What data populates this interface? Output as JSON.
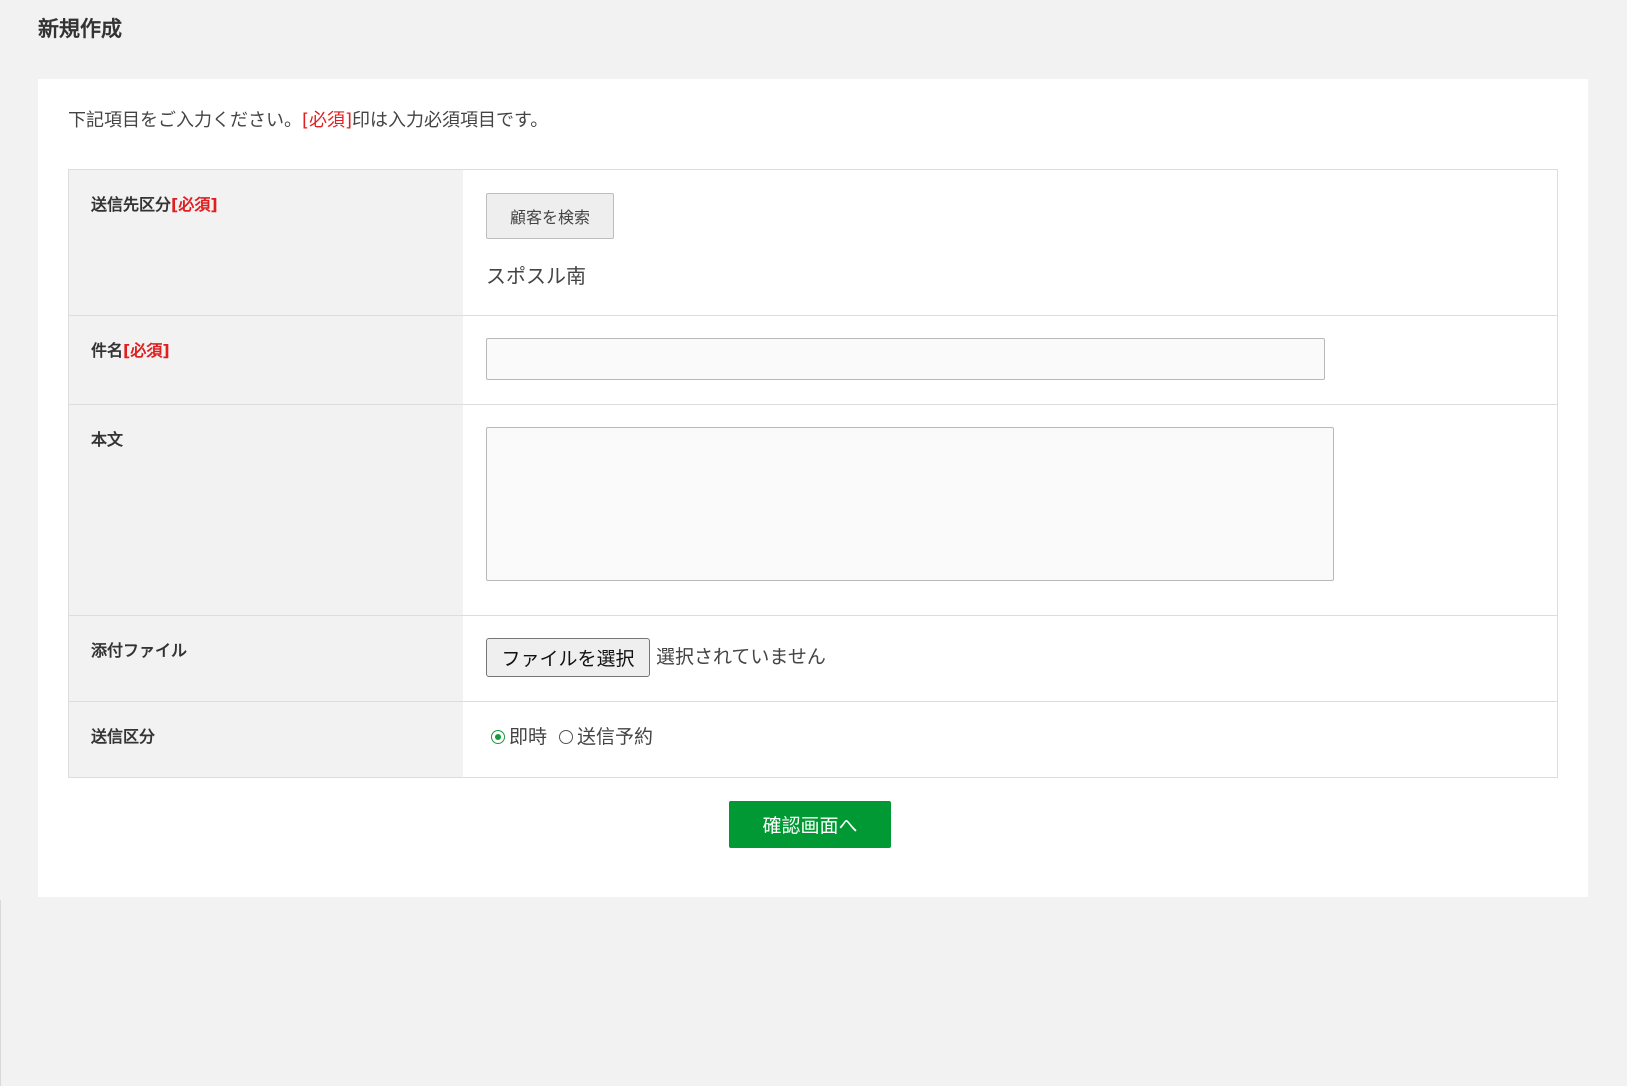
{
  "page": {
    "title": "新規作成"
  },
  "intro": {
    "before": "下記項目をご入力ください。",
    "required_mark": "[必須]",
    "after": "印は入力必須項目です。"
  },
  "form": {
    "required_badge": "[必須]",
    "recipient": {
      "label": "送信先区分",
      "search_button": "顧客を検索",
      "selected_customer": "スポスル南"
    },
    "subject": {
      "label": "件名",
      "value": "",
      "placeholder": ""
    },
    "body": {
      "label": "本文",
      "value": "",
      "placeholder": ""
    },
    "attachment": {
      "label": "添付ファイル",
      "choose_button": "ファイルを選択",
      "status": "選択されていません"
    },
    "send_type": {
      "label": "送信区分",
      "options": [
        {
          "label": "即時",
          "checked": true
        },
        {
          "label": "送信予約",
          "checked": false
        }
      ]
    }
  },
  "actions": {
    "confirm_button": "確認画面へ"
  },
  "colors": {
    "background": "#f2f2f2",
    "panel": "#ffffff",
    "label_cell": "#f2f2f2",
    "required": "#e02020",
    "primary_button": "#009933",
    "radio_checked": "#1a9a3c",
    "text": "#333333"
  }
}
